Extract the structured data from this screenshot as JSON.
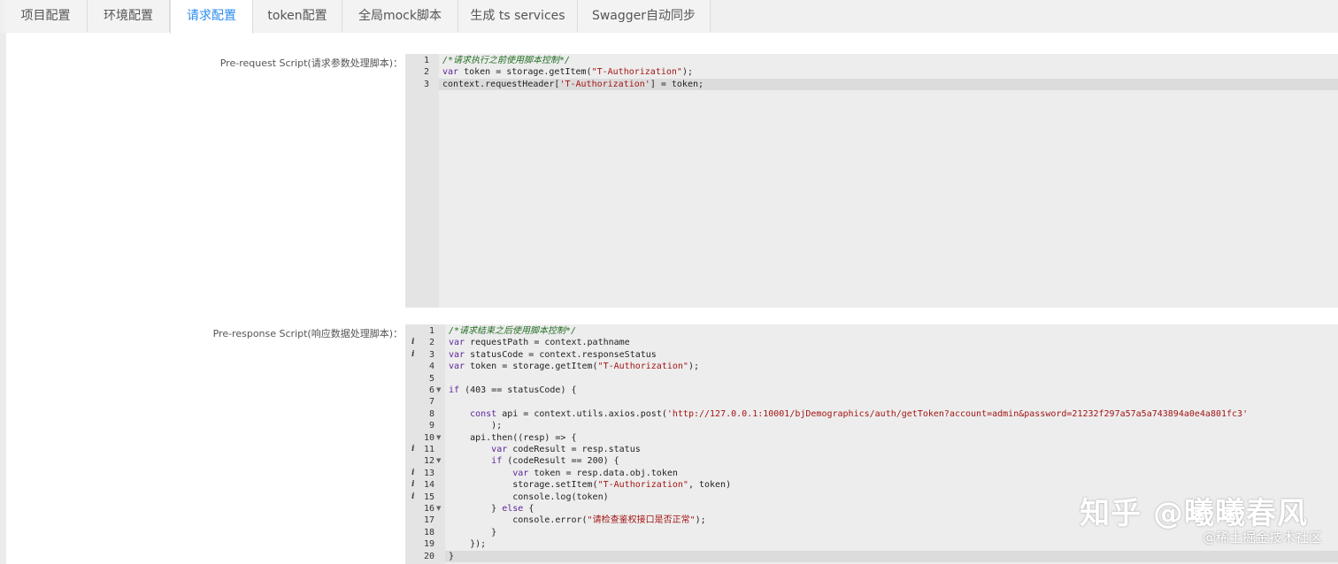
{
  "tabs": [
    {
      "label": "项目配置"
    },
    {
      "label": "环境配置"
    },
    {
      "label": "请求配置"
    },
    {
      "label": "token配置"
    },
    {
      "label": "全局mock脚本"
    },
    {
      "label": "生成 ts services"
    },
    {
      "label": "Swagger自动同步"
    }
  ],
  "active_tab": "请求配置",
  "colors": {
    "accent": "#2d8cf0"
  },
  "pre_request": {
    "label": "Pre-request Script(请求参数处理脚本)：",
    "lines": [
      "/*请求执行之前使用脚本控制*/",
      "var token = storage.getItem(\"T-Authorization\");",
      "context.requestHeader['T-Authorization'] = token;"
    ]
  },
  "pre_response": {
    "label": "Pre-response Script(响应数据处理脚本)：",
    "lines": [
      "/*请求结束之后使用脚本控制*/",
      "var requestPath = context.pathname",
      "var statusCode = context.responseStatus",
      "var token = storage.getItem(\"T-Authorization\");",
      "",
      "if (403 == statusCode) {",
      "",
      "    const api = context.utils.axios.post('http://127.0.0.1:10001/bjDemographics/auth/getToken?account=admin&password=21232f297a57a5a743894a0e4a801fc3'",
      "        );",
      "    api.then((resp) => {",
      "        var codeResult = resp.status",
      "        if (codeResult == 200) {",
      "            var token = resp.data.obj.token",
      "            storage.setItem(\"T-Authorization\", token)",
      "            console.log(token)",
      "        } else {",
      "            console.error(\"请检查鉴权接口是否正常\");",
      "        }",
      "    });",
      "}"
    ]
  },
  "watermark": {
    "zhihu": "知乎 @曦曦春风",
    "juejin": "@稀土掘金技术社区"
  }
}
